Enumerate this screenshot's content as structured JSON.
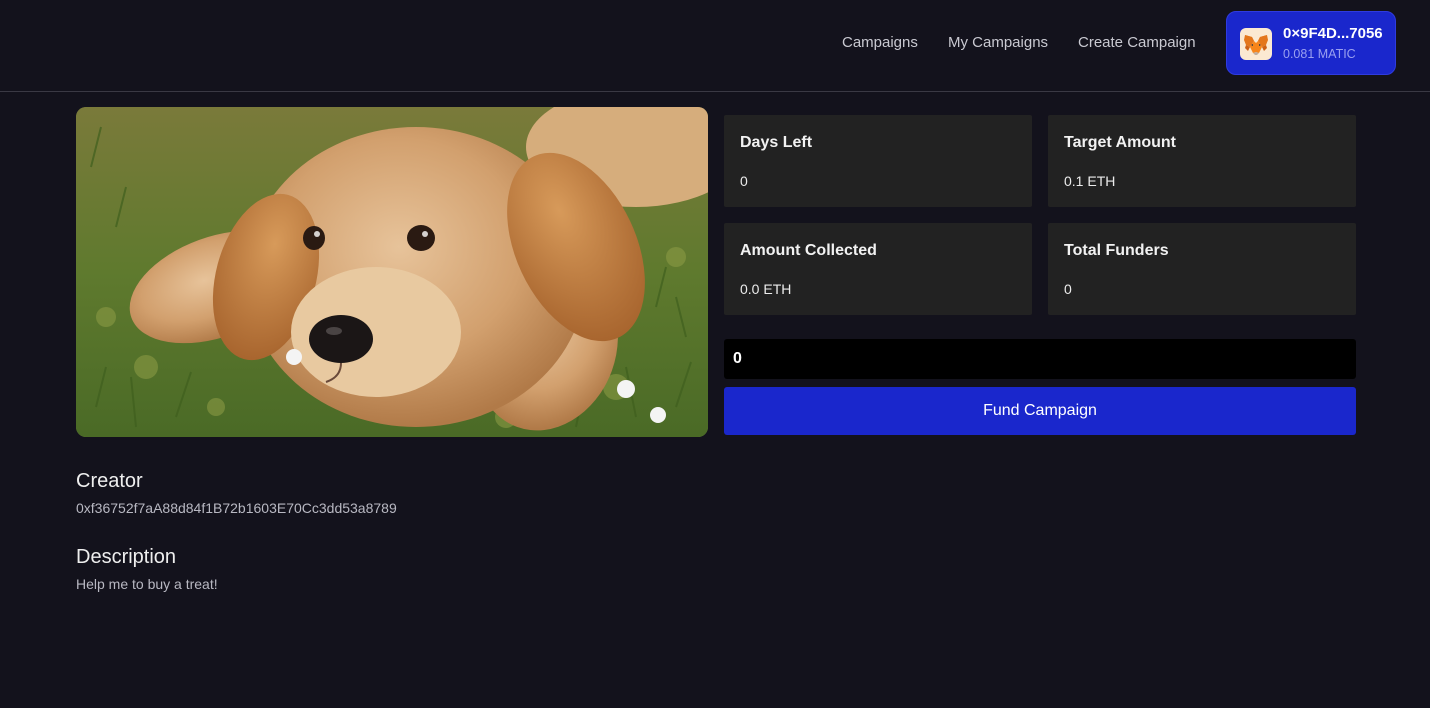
{
  "nav": {
    "links": [
      "Campaigns",
      "My Campaigns",
      "Create Campaign"
    ]
  },
  "wallet": {
    "address": "0×9F4D...7056",
    "balance": "0.081 MATIC",
    "icon": "metamask-fox-icon"
  },
  "campaign": {
    "image_alt": "puppy-photo",
    "stats": {
      "days_left": {
        "label": "Days Left",
        "value": "0"
      },
      "target_amount": {
        "label": "Target Amount",
        "value": "0.1 ETH"
      },
      "amount_collected": {
        "label": "Amount Collected",
        "value": "0.0 ETH"
      },
      "total_funders": {
        "label": "Total Funders",
        "value": "0"
      }
    },
    "fund_input_value": "0",
    "fund_button_label": "Fund Campaign",
    "creator": {
      "heading": "Creator",
      "address": "0xf36752f7aA88d84f1B72b1603E70Cc3dd53a8789"
    },
    "description": {
      "heading": "Description",
      "text": "Help me to buy a treat!"
    }
  },
  "colors": {
    "background": "#13121c",
    "accent": "#1a27cc",
    "card": "#222222"
  }
}
